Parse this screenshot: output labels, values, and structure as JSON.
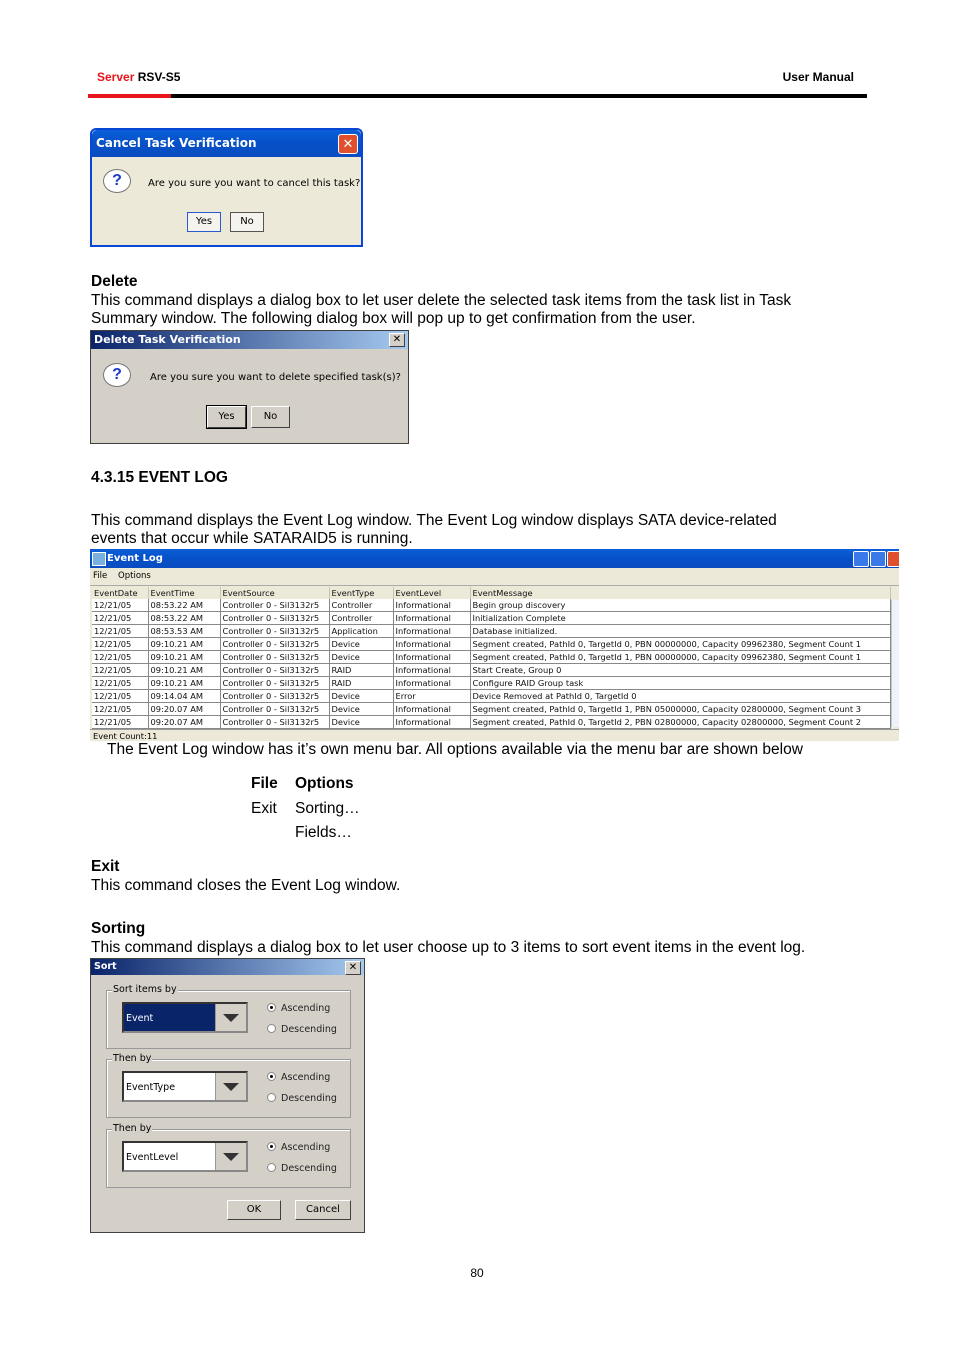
{
  "header": {
    "brand": "Server",
    "model": "RSV-S5",
    "right": "User Manual",
    "accent": "#e8161a"
  },
  "cancel_dialog": {
    "title": "Cancel Task Verification",
    "message": "Are you sure you want to cancel this task?",
    "yes": "Yes",
    "no": "No",
    "icon": "question-icon"
  },
  "delete_section": {
    "heading": "Delete",
    "para_line1": "This command displays a dialog box to let user delete the selected task items from the task list in Task",
    "para_line2": "Summary window.    The following dialog box will pop up to get confirmation from the user."
  },
  "delete_dialog": {
    "title": "Delete Task Verification",
    "message": "Are you sure you want to delete specified task(s)?",
    "yes": "Yes",
    "no": "No",
    "close": "✕"
  },
  "event_section": {
    "heading": "4.3.15 EVENT LOG",
    "para_line1": "This command displays the Event Log window.    The Event Log window displays SATA device-related",
    "para_line2": "events that occur while SATARAID5 is running."
  },
  "event_log": {
    "title": "Event Log",
    "menu": [
      "File",
      "Options"
    ],
    "columns": [
      "EventDate",
      "EventTime",
      "EventSource",
      "EventType",
      "EventLevel",
      "EventMessage"
    ],
    "rows": [
      [
        "12/21/05",
        "08:53.22 AM",
        "Controller 0 - Sil3132r5",
        "Controller",
        "Informational",
        "Begin group discovery"
      ],
      [
        "12/21/05",
        "08:53.22 AM",
        "Controller 0 - Sil3132r5",
        "Controller",
        "Informational",
        "Initialization Complete"
      ],
      [
        "12/21/05",
        "08:53.53 AM",
        "Controller 0 - Sil3132r5",
        "Application",
        "Informational",
        "Database initialized."
      ],
      [
        "12/21/05",
        "09:10.21 AM",
        "Controller 0 - Sil3132r5",
        "Device",
        "Informational",
        "Segment created, PathId 0, TargetId 0, PBN 00000000, Capacity 09962380, Segment Count 1"
      ],
      [
        "12/21/05",
        "09:10.21 AM",
        "Controller 0 - Sil3132r5",
        "Device",
        "Informational",
        "Segment created, PathId 0, TargetId 1, PBN 00000000, Capacity 09962380, Segment Count 1"
      ],
      [
        "12/21/05",
        "09:10.21 AM",
        "Controller 0 - Sil3132r5",
        "RAID",
        "Informational",
        "Start Create, Group 0"
      ],
      [
        "12/21/05",
        "09:10.21 AM",
        "Controller 0 - Sil3132r5",
        "RAID",
        "Informational",
        "Configure RAID Group task"
      ],
      [
        "12/21/05",
        "09:14.04 AM",
        "Controller 0 - Sil3132r5",
        "Device",
        "Error",
        "Device Removed at PathId 0, TargetId 0"
      ],
      [
        "12/21/05",
        "09:20.07 AM",
        "Controller 0 - Sil3132r5",
        "Device",
        "Informational",
        "Segment created, PathId 0, TargetId 1, PBN 05000000, Capacity 02800000, Segment Count 3"
      ],
      [
        "12/21/05",
        "09:20.07 AM",
        "Controller 0 - Sil3132r5",
        "Device",
        "Informational",
        "Segment created, PathId 0, TargetId 2, PBN 02800000, Capacity 02800000, Segment Count 2"
      ]
    ],
    "status": "Event Count:11"
  },
  "menu_section": {
    "intro": "The Event Log window has it’s own menu bar.    All options available via the menu bar are shown below",
    "file_head": "File",
    "options_head": "Options",
    "file_items": [
      "Exit"
    ],
    "options_items": [
      "Sorting…",
      "Fields…"
    ]
  },
  "exit_section": {
    "heading": "Exit",
    "para": "This command closes the Event Log window."
  },
  "sorting_section": {
    "heading": "Sorting",
    "para": "This command displays a dialog box to let user choose up to 3 items to sort event items in the event log."
  },
  "sort_dialog": {
    "title": "Sort",
    "groups": [
      {
        "label": "Sort items by",
        "value": "Event",
        "selected": "Ascending"
      },
      {
        "label": "Then by",
        "value": "EventType",
        "selected": "Ascending"
      },
      {
        "label": "Then by",
        "value": "EventLevel",
        "selected": "Ascending"
      }
    ],
    "ascending": "Ascending",
    "descending": "Descending",
    "ok": "OK",
    "cancel": "Cancel"
  },
  "page_number": "80"
}
